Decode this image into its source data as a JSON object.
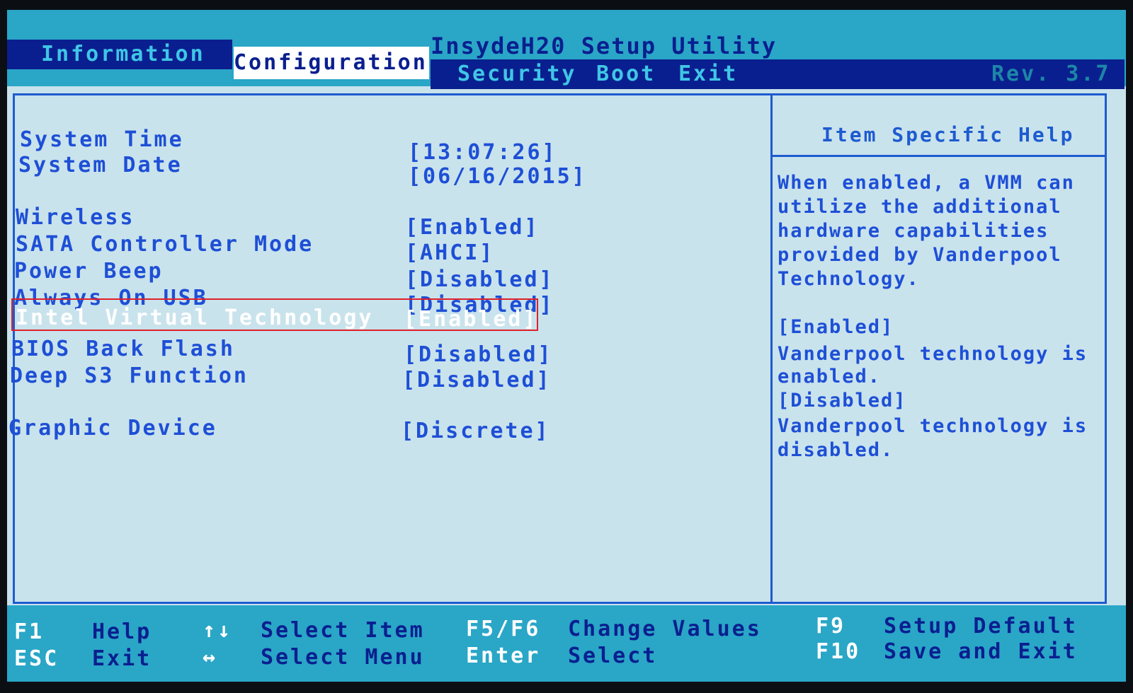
{
  "app": {
    "title": "InsydeH20 Setup Utility",
    "rev": "Rev. 3.7"
  },
  "tabs": [
    {
      "label": "Information"
    },
    {
      "label": "Configuration"
    },
    {
      "label": "Security"
    },
    {
      "label": "Boot"
    },
    {
      "label": "Exit"
    }
  ],
  "settings": [
    {
      "label": "System Time",
      "value": "[13:07:26]"
    },
    {
      "label": "System Date",
      "value": "[06/16/2015]"
    },
    {
      "label": "Wireless",
      "value": "[Enabled]"
    },
    {
      "label": "SATA Controller Mode",
      "value": "[AHCI]"
    },
    {
      "label": "Power Beep",
      "value": "[Disabled]"
    },
    {
      "label": "Always On USB",
      "value": "[Disabled]"
    },
    {
      "label": "Intel Virtual Technology",
      "value": "[Enabled]"
    },
    {
      "label": "BIOS Back Flash",
      "value": "[Disabled]"
    },
    {
      "label": "Deep S3 Function",
      "value": "[Disabled]"
    },
    {
      "label": "Graphic Device",
      "value": "[Discrete]"
    }
  ],
  "help": {
    "title": "Item Specific Help",
    "lines": [
      "When enabled, a VMM can",
      "utilize the additional",
      "hardware capabilities",
      "provided by Vanderpool",
      "Technology.",
      "[Enabled]",
      "Vanderpool technology is",
      "enabled.",
      "[Disabled]",
      "Vanderpool technology is",
      "disabled."
    ]
  },
  "footer": {
    "f1_key": "F1",
    "f1_desc": "Help",
    "esc_key": "ESC",
    "esc_desc": "Exit",
    "updown_key": "↑↓",
    "updown_desc": "Select Item",
    "leftright_key": "↔",
    "leftright_desc": "Select Menu",
    "f5f6_key": "F5/F6",
    "f5f6_desc": "Change Values",
    "enter_key": "Enter",
    "enter_desc": "Select",
    "f9_key": "F9",
    "f9_desc": "Setup Default",
    "f10_key": "F10",
    "f10_desc": "Save and Exit"
  },
  "colors": {
    "selected_outline": "#e0202a",
    "text": "#1e4fd6",
    "header": "#2aa6c7"
  }
}
